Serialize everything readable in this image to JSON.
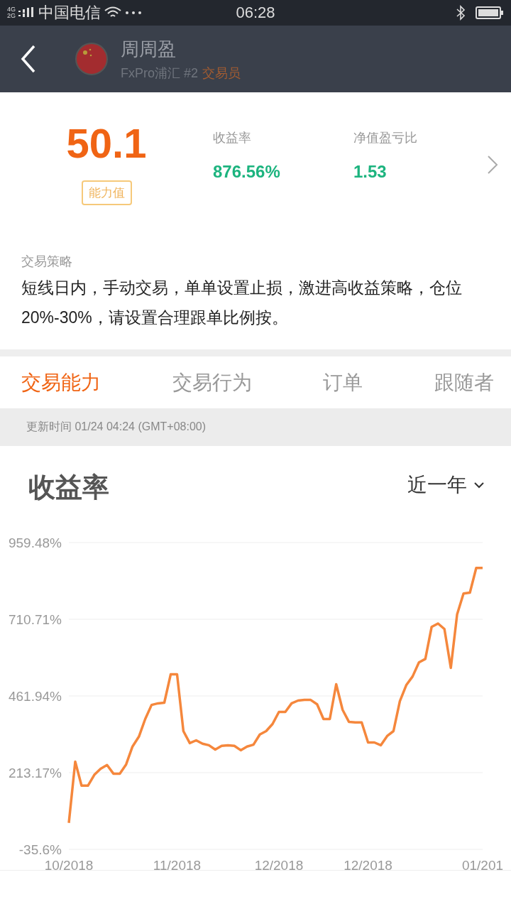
{
  "status_bar": {
    "network": [
      "4G",
      "2G"
    ],
    "carrier": "中国电信",
    "time": "06:28"
  },
  "header": {
    "name": "周周盈",
    "broker": "FxPro浦汇 #2",
    "role": "交易员"
  },
  "summary": {
    "score": "50.1",
    "score_label": "能力值",
    "stats": [
      {
        "label": "收益率",
        "value": "876.56%"
      },
      {
        "label": "净值盈亏比",
        "value": "1.53"
      }
    ]
  },
  "strategy": {
    "title": "交易策略",
    "text": "短线日内，手动交易，单单设置止损，激进高收益策略，仓位20%-30%，请设置合理跟单比例按。"
  },
  "tabs": [
    {
      "label": "交易能力",
      "selected": true
    },
    {
      "label": "交易行为",
      "selected": false
    },
    {
      "label": "订单",
      "selected": false
    },
    {
      "label": "跟随者",
      "selected": false
    }
  ],
  "updated": "更新时间 01/24 04:24 (GMT+08:00)",
  "chart_panel": {
    "title": "收益率",
    "period": "近一年",
    "chart_data": {
      "type": "line",
      "categories": [
        "10/2018",
        null,
        null,
        null,
        null,
        null,
        null,
        null,
        null,
        null,
        null,
        null,
        null,
        null,
        null,
        null,
        null,
        "11/2018",
        null,
        null,
        null,
        null,
        null,
        null,
        null,
        null,
        null,
        null,
        null,
        null,
        null,
        null,
        null,
        "12/2018",
        null,
        null,
        null,
        null,
        null,
        null,
        null,
        null,
        null,
        null,
        null,
        null,
        null,
        "12/2018",
        null,
        null,
        null,
        null,
        null,
        null,
        null,
        null,
        null,
        null,
        null,
        null,
        null,
        null,
        null,
        null,
        null,
        "01/201"
      ],
      "series": [
        {
          "color": "#f5873c",
          "values": [
            50,
            249,
            171,
            171,
            206,
            226,
            238,
            210,
            210,
            240,
            298,
            330,
            387,
            433,
            438,
            440,
            532,
            532,
            348,
            309,
            318,
            307,
            302,
            288,
            300,
            302,
            300,
            286,
            298,
            304,
            337,
            348,
            371,
            410,
            410,
            438,
            447,
            449,
            449,
            435,
            387,
            387,
            500,
            417,
            378,
            376,
            376,
            311,
            311,
            302,
            332,
            348,
            445,
            497,
            525,
            571,
            582,
            686,
            697,
            679,
            553,
            727,
            794,
            797,
            877,
            877
          ]
        }
      ],
      "ylim": [
        -35.6,
        959.48
      ],
      "grid": true,
      "yticks": [
        {
          "value": 959.48,
          "label": "959.48%"
        },
        {
          "value": 710.71,
          "label": "710.71%"
        },
        {
          "value": 461.94,
          "label": "461.94%"
        },
        {
          "value": 213.17,
          "label": "213.17%"
        },
        {
          "value": -35.6,
          "label": "-35.6%"
        }
      ]
    }
  }
}
